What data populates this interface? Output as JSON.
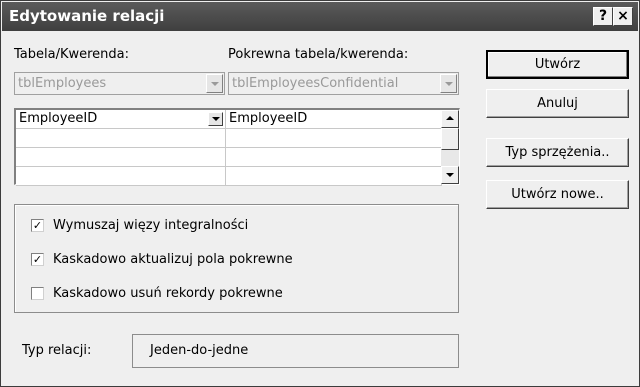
{
  "window": {
    "title": "Edytowanie relacji",
    "help_label": "?",
    "close_label": "×"
  },
  "table_label": "Tabela/Kwerenda:",
  "related_label": "Pokrewna tabela/kwerenda:",
  "table_value": "tblEmployees",
  "related_value": "tblEmployeesConfidential",
  "fields": [
    {
      "left": "EmployeeID",
      "right": "EmployeeID"
    },
    {
      "left": "",
      "right": ""
    },
    {
      "left": "",
      "right": ""
    },
    {
      "left": "",
      "right": ""
    }
  ],
  "buttons": {
    "create": "Utwórz",
    "cancel": "Anuluj",
    "join_type": "Typ sprzężenia..",
    "create_new": "Utwórz nowe.."
  },
  "options": [
    {
      "label": "Wymuszaj więzy integralności",
      "checked": true
    },
    {
      "label": "Kaskadowo aktualizuj pola pokrewne",
      "checked": true
    },
    {
      "label": "Kaskadowo usuń rekordy pokrewne",
      "checked": false
    }
  ],
  "relation_type_label": "Typ relacji:",
  "relation_type_value": "Jeden-do-jedne"
}
